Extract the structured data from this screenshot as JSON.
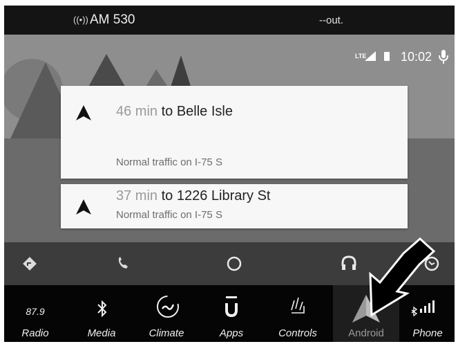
{
  "top_bar": {
    "radio_label": "AM 530",
    "status": "--out."
  },
  "aa_status": {
    "network": "LTE",
    "time": "10:02"
  },
  "cards": [
    {
      "eta": "46 min",
      "destination": "to Belle Isle",
      "traffic": "Normal traffic on I-75 S"
    },
    {
      "eta": "37 min",
      "destination": "to 1226 Library St",
      "traffic": "Normal traffic on I-75 S"
    }
  ],
  "aa_nav": [
    "navigation-icon",
    "phone-icon",
    "home-icon",
    "headphones-icon",
    "exit-icon"
  ],
  "uconnect": {
    "radio_freq": "87.9",
    "items": [
      {
        "label": "Radio",
        "icon": "radio"
      },
      {
        "label": "Media",
        "icon": "bluetooth-icon"
      },
      {
        "label": "Climate",
        "icon": "climate-icon"
      },
      {
        "label": "Apps",
        "icon": "apps-icon"
      },
      {
        "label": "Controls",
        "icon": "controls-icon"
      },
      {
        "label": "Android",
        "icon": "android-auto-icon"
      },
      {
        "label": "Phone",
        "icon": "phone-signal-icon"
      }
    ]
  }
}
